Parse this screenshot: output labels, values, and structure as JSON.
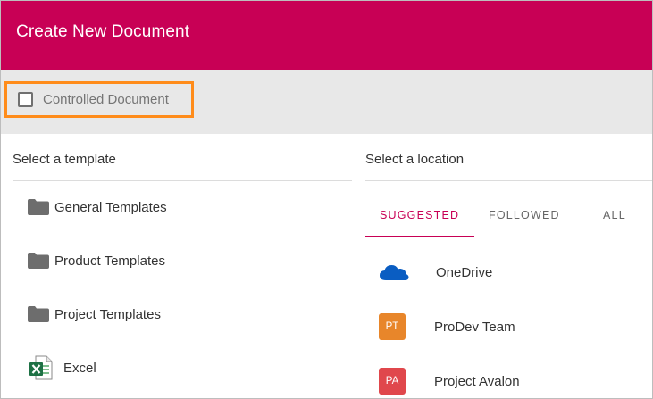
{
  "dialog": {
    "title": "Create New Document"
  },
  "toolbar": {
    "controlled_document_label": "Controlled Document",
    "controlled_document_checked": false,
    "highlight_color": "#ff8c1a"
  },
  "templates": {
    "heading": "Select a template",
    "items": [
      {
        "label": "General Templates",
        "icon": "folder-icon"
      },
      {
        "label": "Product Templates",
        "icon": "folder-icon"
      },
      {
        "label": "Project Templates",
        "icon": "folder-icon"
      },
      {
        "label": "Excel",
        "icon": "excel-icon"
      }
    ]
  },
  "locations": {
    "heading": "Select a location",
    "tabs": [
      {
        "label": "SUGGESTED",
        "active": true
      },
      {
        "label": "FOLLOWED",
        "active": false
      },
      {
        "label": "ALL",
        "active": false
      }
    ],
    "items": [
      {
        "label": "OneDrive",
        "icon": "onedrive-icon"
      },
      {
        "label": "ProDev Team",
        "badge": "PT",
        "badge_color": "#e8862a"
      },
      {
        "label": "Project Avalon",
        "badge": "PA",
        "badge_color": "#e0474c"
      }
    ]
  },
  "colors": {
    "brand": "#c80055",
    "toolbar_bg": "#e8e8e8"
  }
}
